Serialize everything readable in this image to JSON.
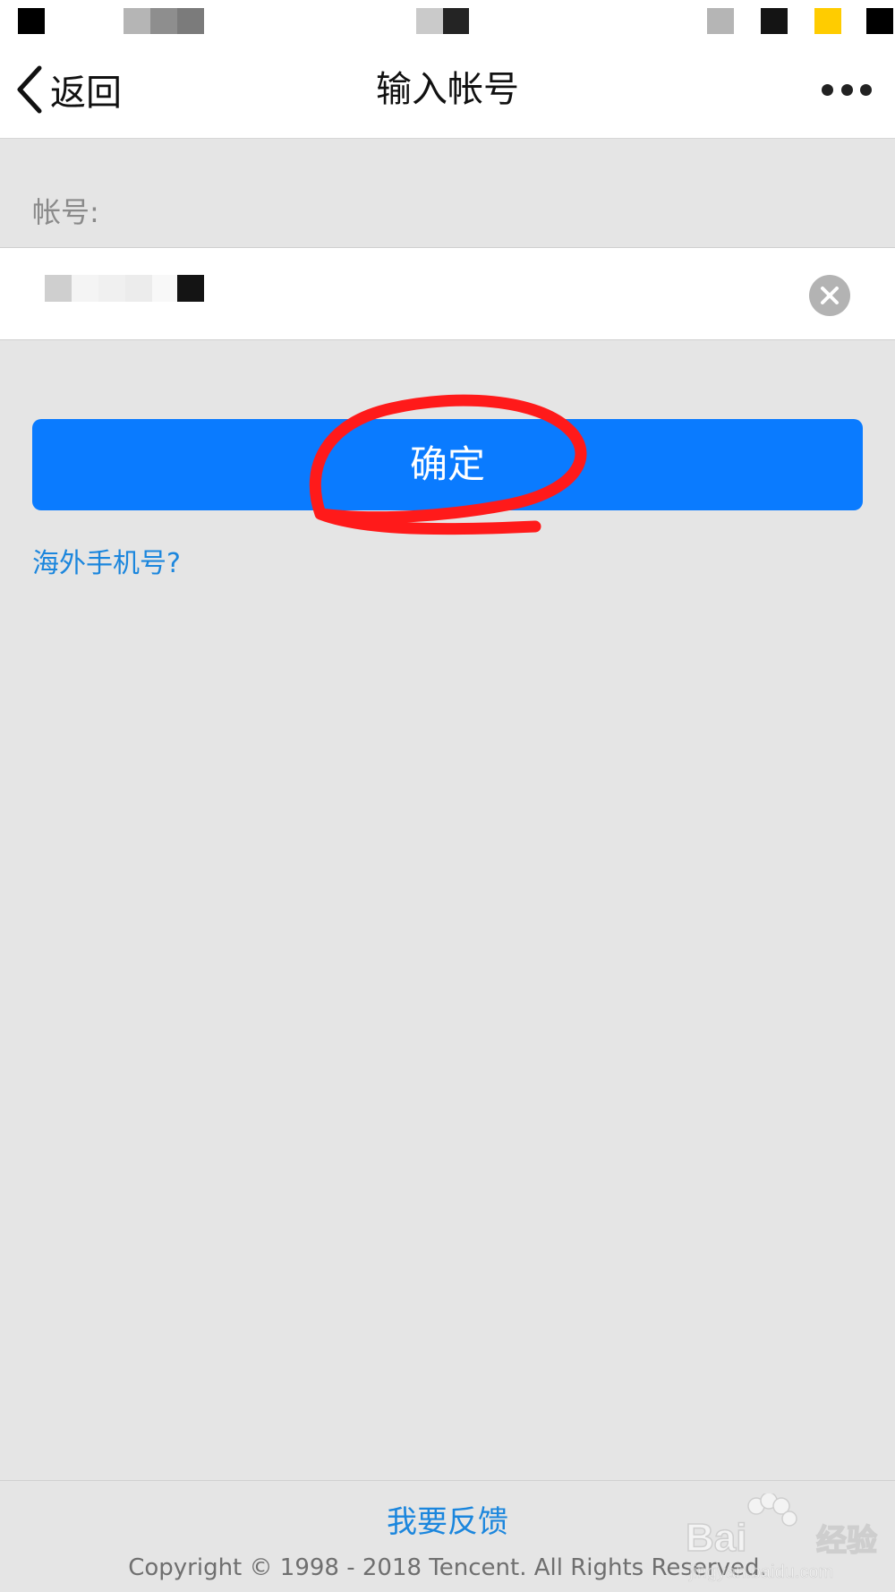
{
  "nav": {
    "back_label": "返回",
    "title": "输入帐号"
  },
  "form": {
    "account_label": "帐号:",
    "account_value": "",
    "confirm_label": "确定",
    "overseas_link": "海外手机号?"
  },
  "footer": {
    "feedback_link": "我要反馈",
    "copyright": "Copyright © 1998 - 2018 Tencent. All Rights Reserved."
  },
  "watermark": {
    "brand": "Baidu经验",
    "url": "jingyan.baidu.com"
  },
  "icons": {
    "back": "chevron-left-icon",
    "more": "more-dots-icon",
    "clear": "clear-circle-icon"
  },
  "colors": {
    "primary": "#0a7bff",
    "link": "#1b86dd",
    "background": "#e5e5e5",
    "annotation": "#ff1a1a"
  }
}
